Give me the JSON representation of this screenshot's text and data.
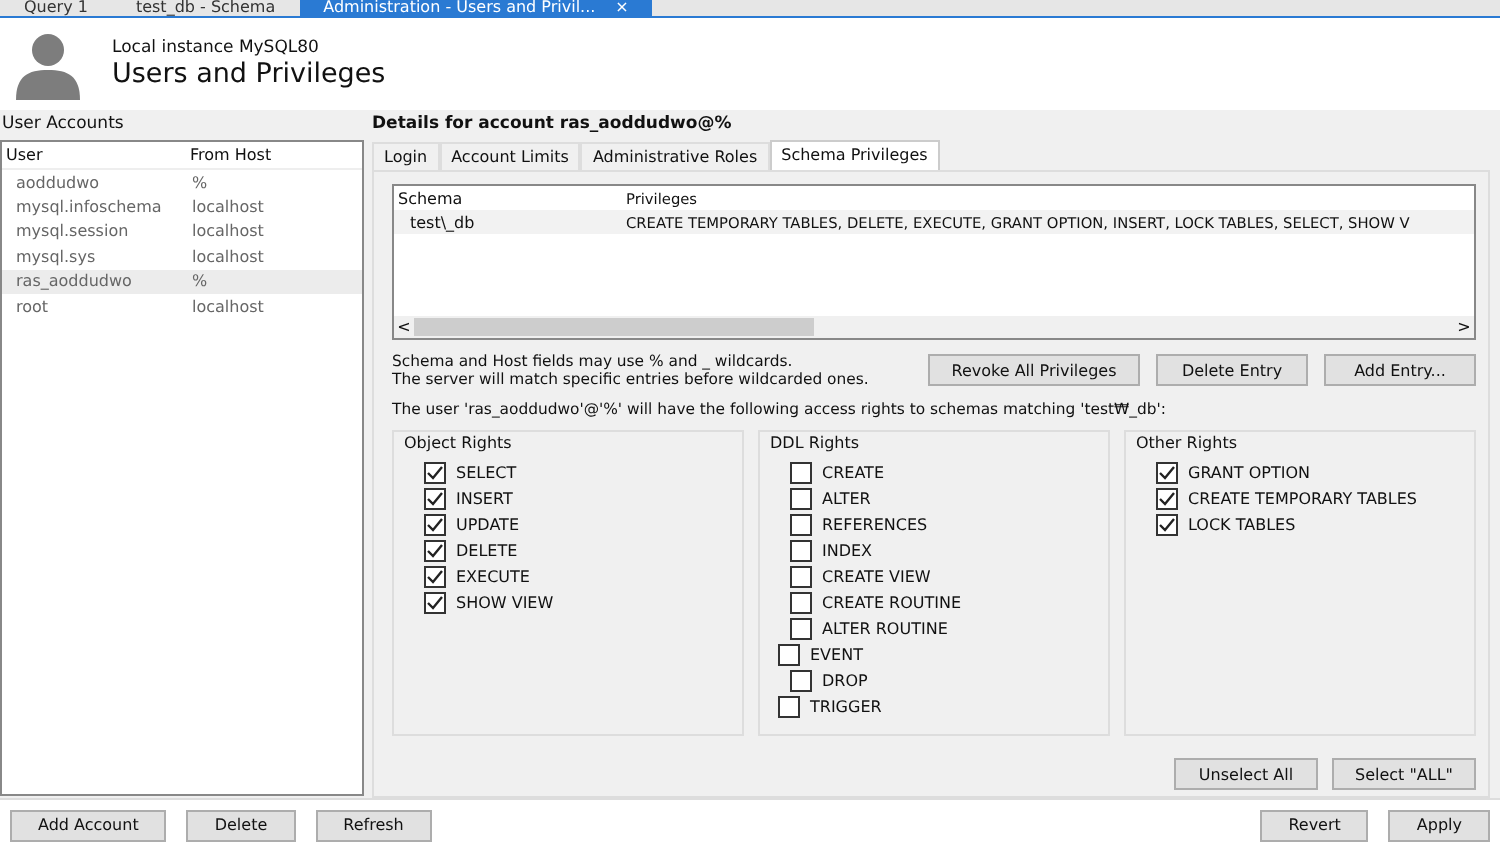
{
  "doc_tabs": [
    {
      "label": "Query 1",
      "selected": false
    },
    {
      "label": "test_db - Schema",
      "selected": false
    },
    {
      "label": "Administration - Users and Privil...",
      "selected": true,
      "close": "×"
    }
  ],
  "header": {
    "subtitle": "Local instance MySQL80",
    "title": "Users and Privileges"
  },
  "accounts": {
    "label": "User Accounts",
    "columns": [
      "User",
      "From Host"
    ],
    "rows": [
      {
        "user": "aoddudwo",
        "host": "%",
        "selected": false
      },
      {
        "user": "mysql.infoschema",
        "host": "localhost",
        "selected": false
      },
      {
        "user": "mysql.session",
        "host": "localhost",
        "selected": false
      },
      {
        "user": "mysql.sys",
        "host": "localhost",
        "selected": false
      },
      {
        "user": "ras_aoddudwo",
        "host": "%",
        "selected": true
      },
      {
        "user": "root",
        "host": "localhost",
        "selected": false
      }
    ]
  },
  "details": {
    "title": "Details for account ras_aoddudwo@%",
    "tabs": [
      {
        "label": "Login",
        "selected": false
      },
      {
        "label": "Account Limits",
        "selected": false
      },
      {
        "label": "Administrative Roles",
        "selected": false
      },
      {
        "label": "Schema Privileges",
        "selected": true
      }
    ],
    "schema_table": {
      "columns": [
        "Schema",
        "Privileges"
      ],
      "rows": [
        {
          "schema": "test\\_db",
          "privileges": "CREATE TEMPORARY TABLES, DELETE, EXECUTE, GRANT OPTION, INSERT, LOCK TABLES, SELECT, SHOW V"
        }
      ],
      "scroll_left": "<",
      "scroll_right": ">"
    },
    "hint": [
      "Schema and Host fields may use % and _ wildcards.",
      "The server will match specific entries before wildcarded ones."
    ],
    "entry_buttons": [
      "Revoke All Privileges",
      "Delete Entry",
      "Add Entry..."
    ],
    "rights_note": "The user 'ras_aoddudwo'@'%' will have the following access rights to schemas matching 'test₩_db':",
    "groups": [
      {
        "title": "Object Rights",
        "items": [
          {
            "label": "SELECT",
            "checked": true,
            "kind": "indented"
          },
          {
            "label": "INSERT",
            "checked": true,
            "kind": "indented"
          },
          {
            "label": "UPDATE",
            "checked": true,
            "kind": "indented"
          },
          {
            "label": "DELETE",
            "checked": true,
            "kind": "indented"
          },
          {
            "label": "EXECUTE",
            "checked": true,
            "kind": "indented"
          },
          {
            "label": "SHOW VIEW",
            "checked": true,
            "kind": "indented"
          }
        ]
      },
      {
        "title": "DDL Rights",
        "items": [
          {
            "label": "CREATE",
            "checked": false,
            "kind": "indented"
          },
          {
            "label": "ALTER",
            "checked": false,
            "kind": "indented"
          },
          {
            "label": "REFERENCES",
            "checked": false,
            "kind": "indented"
          },
          {
            "label": "INDEX",
            "checked": false,
            "kind": "indented"
          },
          {
            "label": "CREATE VIEW",
            "checked": false,
            "kind": "indented"
          },
          {
            "label": "CREATE ROUTINE",
            "checked": false,
            "kind": "indented"
          },
          {
            "label": "ALTER ROUTINE",
            "checked": false,
            "kind": "indented"
          },
          {
            "label": "EVENT",
            "checked": false,
            "kind": "outdented"
          },
          {
            "label": "DROP",
            "checked": false,
            "kind": "indented"
          },
          {
            "label": "TRIGGER",
            "checked": false,
            "kind": "outdented"
          }
        ]
      },
      {
        "title": "Other Rights",
        "items": [
          {
            "label": "GRANT OPTION",
            "checked": true,
            "kind": "indented"
          },
          {
            "label": "CREATE TEMPORARY TABLES",
            "checked": true,
            "kind": "indented"
          },
          {
            "label": "LOCK TABLES",
            "checked": true,
            "kind": "indented"
          }
        ]
      }
    ],
    "select_buttons": [
      "Unselect All",
      "Select \"ALL\""
    ]
  },
  "footer": {
    "left_buttons": [
      "Add Account",
      "Delete",
      "Refresh"
    ],
    "right_buttons": [
      "Revert",
      "Apply"
    ]
  }
}
